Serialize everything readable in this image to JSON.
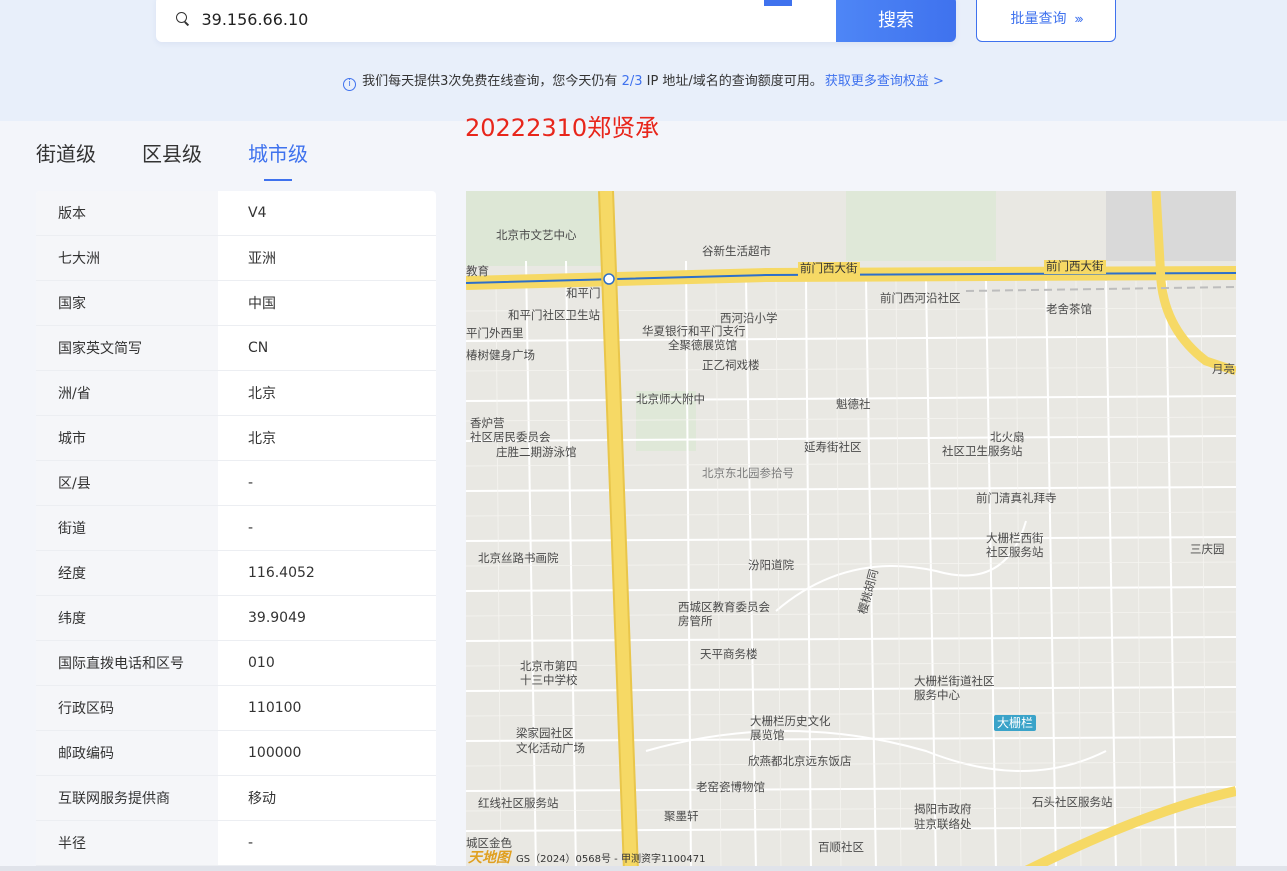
{
  "search": {
    "value": "39.156.66.10",
    "button_label": "搜索",
    "batch_label": "批量查询",
    "batch_arrows": "›››"
  },
  "notice": {
    "prefix": "我们每天提供3次免费在线查询，您今天仍有 ",
    "quota": "2/3",
    "suffix": " IP 地址/域名的查询额度可用。",
    "link": "获取更多查询权益 >"
  },
  "overlay_text": "20222310郑贤承",
  "level_tabs": [
    {
      "label": "街道级",
      "active": false
    },
    {
      "label": "区县级",
      "active": false
    },
    {
      "label": "城市级",
      "active": true
    }
  ],
  "info_rows": [
    {
      "key": "版本",
      "value": "V4"
    },
    {
      "key": "七大洲",
      "value": "亚洲"
    },
    {
      "key": "国家",
      "value": "中国"
    },
    {
      "key": "国家英文简写",
      "value": "CN"
    },
    {
      "key": "洲/省",
      "value": "北京"
    },
    {
      "key": "城市",
      "value": "北京"
    },
    {
      "key": "区/县",
      "value": "-"
    },
    {
      "key": "街道",
      "value": "-"
    },
    {
      "key": "经度",
      "value": "116.4052"
    },
    {
      "key": "纬度",
      "value": "39.9049"
    },
    {
      "key": "国际直拨电话和区号",
      "value": "010"
    },
    {
      "key": "行政区码",
      "value": "110100"
    },
    {
      "key": "邮政编码",
      "value": "100000"
    },
    {
      "key": "互联网服务提供商",
      "value": "移动"
    },
    {
      "key": "半径",
      "value": "-"
    }
  ],
  "map": {
    "labels": {
      "l1": "北京市文艺中心",
      "l2": "谷新生活超市",
      "l3": "前门西大街",
      "l4": "前门西大街",
      "l5": "和平门",
      "l6": "前门西河沿社区",
      "l7": "老舍茶馆",
      "l8": "和平门社区卫生站",
      "l9": "西河沿小学",
      "l10": "华夏银行和平门支行",
      "l11": "全聚德展览馆",
      "l12": "正乙祠戏楼",
      "l13": "北京师大附中",
      "l14": "魁德社",
      "l15": "香炉营",
      "l16": "社区居民委员会",
      "l17": "庄胜二期游泳馆",
      "l18": "延寿街社区",
      "l19": "北火扇",
      "l20": "社区卫生服务站",
      "l21": "北京东北园参拾号",
      "l22": "前门清真礼拜寺",
      "l23": "大栅栏西街",
      "l24": "社区服务站",
      "l25": "北京丝路书画院",
      "l26": "汾阳道院",
      "l27": "三庆园",
      "l28": "西城区教育委员会",
      "l29": "房管所",
      "l30": "樱桃胡同",
      "l31": "北京市第四",
      "l32": "十三中学校",
      "l33": "天平商务楼",
      "l34": "大栅栏街道社区",
      "l35": "服务中心",
      "l36": "大栅栏历史文化",
      "l37": "展览馆",
      "l38": "大栅栏",
      "l39": "梁家园社区",
      "l40": "文化活动广场",
      "l41": "欣燕都北京远东饭店",
      "l42": "老窑瓷博物馆",
      "l43": "红线社区服务站",
      "l44": "聚墨轩",
      "l45": "揭阳市政府",
      "l46": "驻京联络处",
      "l47": "石头社区服务站",
      "l48": "百顺社区",
      "l49": "平门外西里",
      "l50": "椿树健身广场",
      "l51": "城区金色",
      "l52": "教育",
      "l53": "月亮"
    },
    "footer": "GS（2024）0568号 - 甲测资字1100471",
    "logo": "天地图"
  },
  "colors": {
    "accent": "#3f72ee",
    "overlay": "#e8261b",
    "road": "#f6d965"
  }
}
